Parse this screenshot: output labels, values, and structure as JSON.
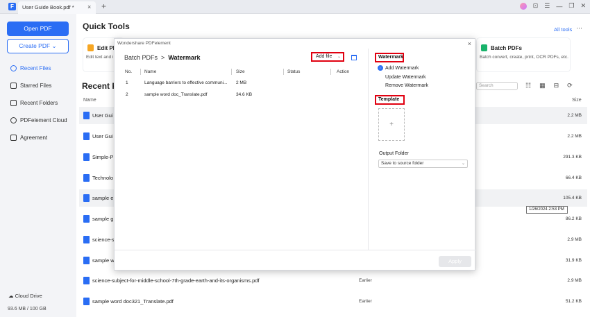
{
  "window": {
    "tab_title": "User Guide Book.pdf *",
    "tab_close": "×",
    "tab_add": "+",
    "logo": "F",
    "controls": [
      "⊡",
      "☰",
      "—",
      "❐",
      "✕"
    ]
  },
  "sidebar": {
    "open_pdf": "Open PDF",
    "create_pdf": "Create PDF ⌄",
    "items": [
      {
        "label": "Recent Files",
        "icon": "clock-icon",
        "active": true
      },
      {
        "label": "Starred Files",
        "icon": "star-icon",
        "active": false
      },
      {
        "label": "Recent Folders",
        "icon": "folder-icon",
        "active": false
      },
      {
        "label": "PDFelement Cloud",
        "icon": "cloud-icon",
        "active": false
      },
      {
        "label": "Agreement",
        "icon": "document-icon",
        "active": false
      }
    ],
    "cloud_drive": "Cloud Drive",
    "storage": "93.6 MB / 100 GB"
  },
  "main": {
    "quick_tools_title": "Quick Tools",
    "all_tools": "All tools",
    "more": "···",
    "tools": [
      {
        "name": "Edit PDF",
        "desc": "Edit text and i"
      },
      {
        "name": "Batch PDFs",
        "desc": "Batch convert, create, print, OCR PDFs, etc."
      }
    ],
    "recent_title": "Recent Fi",
    "search_placeholder": "Search",
    "col_name": "Name",
    "col_size": "Size",
    "files": [
      {
        "name": "User Gui",
        "date": "",
        "size": "2.2 MB"
      },
      {
        "name": "User Gui",
        "date": "",
        "size": "2.2 MB"
      },
      {
        "name": "Simple-P",
        "date": "",
        "size": "291.3 KB"
      },
      {
        "name": "Technolo",
        "date": "",
        "size": "66.4 KB"
      },
      {
        "name": "sample e",
        "date": "",
        "size": "105.4 KB"
      },
      {
        "name": "sample g",
        "date": "",
        "size": "86.2 KB"
      },
      {
        "name": "science-s",
        "date": "",
        "size": "2.9 MB"
      },
      {
        "name": "sample w",
        "date": "",
        "size": "31.9 KB"
      },
      {
        "name": "science-subject-for-middle-school-7th-grade-earth-and-its-organisms.pdf",
        "date": "Earlier",
        "size": "2.9 MB"
      },
      {
        "name": "sample word doc321_Translate.pdf",
        "date": "Earlier",
        "size": "51.2 KB"
      }
    ],
    "tooltip": "1/26/2024 2:53 PM"
  },
  "modal": {
    "title": "Wondershare PDFelement",
    "close": "×",
    "breadcrumb_parent": "Batch PDFs",
    "breadcrumb_sep": ">",
    "breadcrumb_current": "Watermark",
    "add_file": "Add file",
    "add_file_arrow": "⌄",
    "columns": [
      "No.",
      "Name",
      "Size",
      "Status",
      "Action"
    ],
    "rows": [
      {
        "no": "1",
        "name": "Language barriers to effective communi...",
        "size": "2 MB"
      },
      {
        "no": "2",
        "name": "sample word doc_Translate.pdf",
        "size": "34.6 KB"
      }
    ],
    "watermark_label": "Watermark",
    "options": [
      {
        "label": "Add Watermark",
        "selected": true
      },
      {
        "label": "Update Watermark",
        "selected": false
      },
      {
        "label": "Remove Watermark",
        "selected": false
      }
    ],
    "template_label": "Template",
    "template_add": "+",
    "output_folder_label": "Output Folder",
    "output_folder_value": "Save to source folder",
    "apply": "Apply"
  },
  "colors": {
    "accent": "#2a6df4",
    "highlight": "#e00010"
  }
}
